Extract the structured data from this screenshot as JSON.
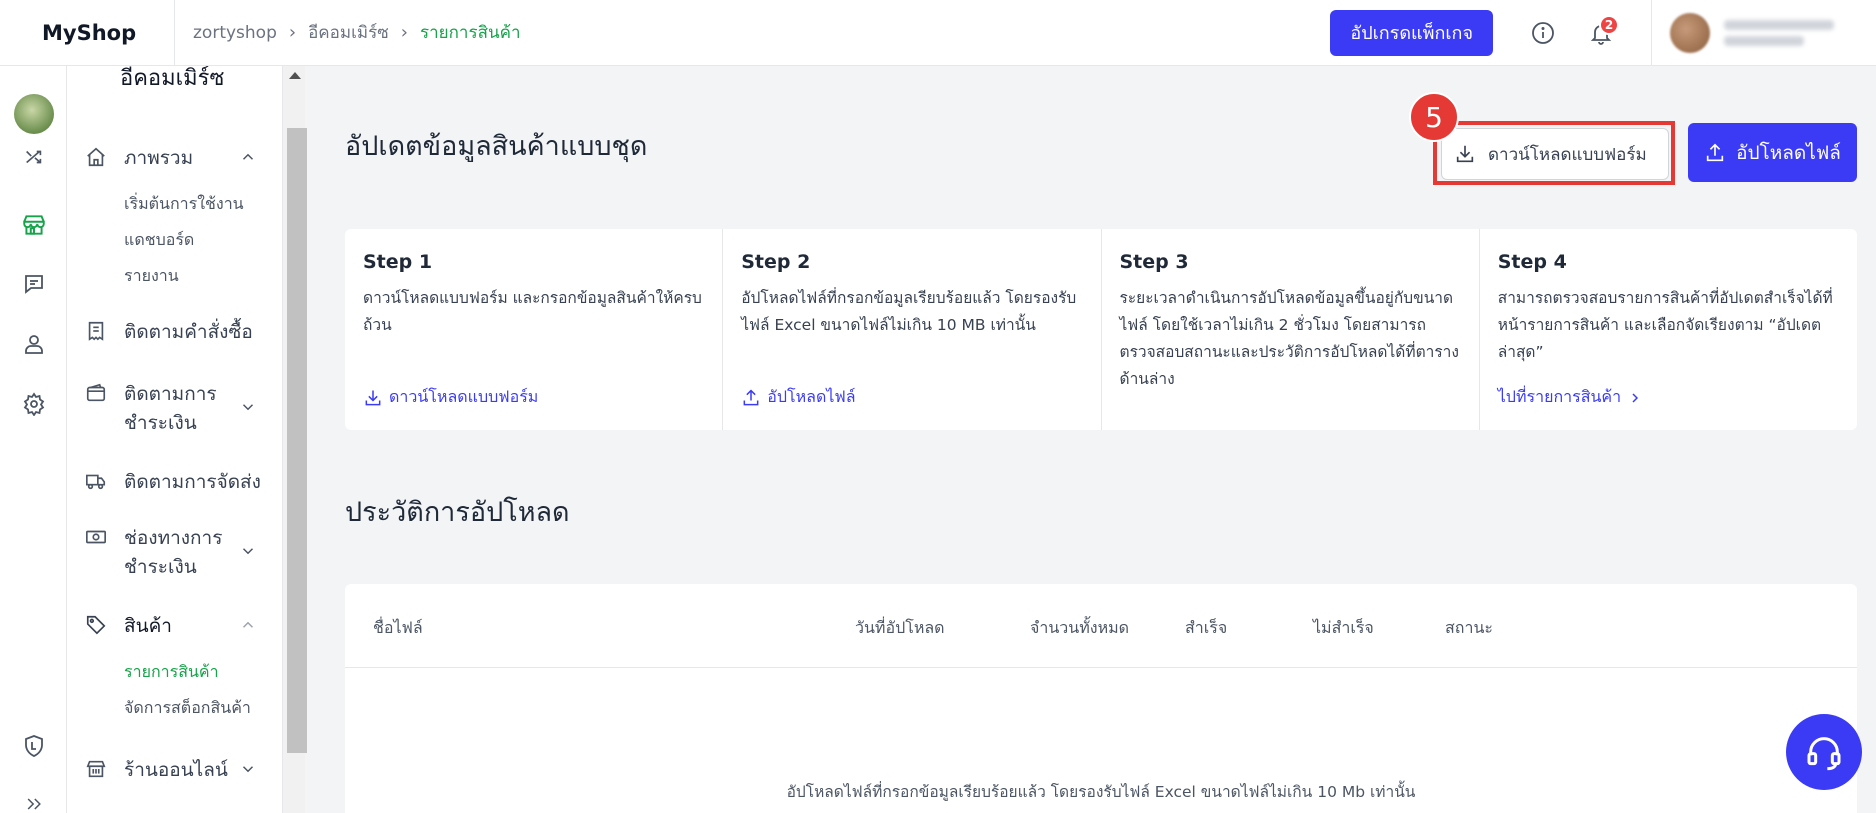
{
  "header": {
    "logo": "MyShop",
    "breadcrumb": [
      "zortyshop",
      "อีคอมเมิร์ซ",
      "รายการสินค้า"
    ],
    "upgrade_label": "อัปเกรดแพ็กเกจ",
    "notification_count": "2"
  },
  "sidebar": {
    "title": "อีคอมเมิร์ซ",
    "overview": "ภาพรวม",
    "overview_subs": [
      "เริ่มต้นการใช้งาน",
      "แดชบอร์ด",
      "รายงาน"
    ],
    "orders": "ติดตามคำสั่งซื้อ",
    "payments_line1": "ติดตามการ",
    "payments_line2": "ชำระเงิน",
    "shipping": "ติดตามการจัดส่ง",
    "channels_line1": "ช่องทางการ",
    "channels_line2": "ชำระเงิน",
    "products": "สินค้า",
    "product_subs": [
      "รายการสินค้า",
      "จัดการสต็อกสินค้า"
    ],
    "online_store": "ร้านออนไลน์"
  },
  "main": {
    "title": "อัปเดตข้อมูลสินค้าแบบชุด",
    "download_form_label": "ดาวน์โหลดแบบฟอร์ม",
    "upload_file_label": "อัปโหลดไฟล์",
    "annotation_number": "5",
    "steps": [
      {
        "title": "Step 1",
        "desc": "ดาวน์โหลดแบบฟอร์ม และกรอกข้อมูลสินค้าให้ครบถ้วน",
        "link": "ดาวน์โหลดแบบฟอร์ม"
      },
      {
        "title": "Step 2",
        "desc": "อัปโหลดไฟล์ที่กรอกข้อมูลเรียบร้อยแล้ว โดยรองรับไฟล์ Excel ขนาดไฟล์ไม่เกิน 10 MB เท่านั้น",
        "link": "อัปโหลดไฟล์"
      },
      {
        "title": "Step 3",
        "desc": "ระยะเวลาดำเนินการอัปโหลดข้อมูลขึ้นอยู่กับขนาดไฟล์ โดยใช้เวลาไม่เกิน 2 ชั่วโมง โดยสามารถตรวจสอบสถานะและประวัติการอัปโหลดได้ที่ตารางด้านล่าง"
      },
      {
        "title": "Step 4",
        "desc": "สามารถตรวจสอบรายการสินค้าที่อัปเดตสำเร็จได้ที่หน้ารายการสินค้า และเลือกจัดเรียงตาม “อัปเดตล่าสุด”",
        "link": "ไปที่รายการสินค้า"
      }
    ],
    "history_title": "ประวัติการอัปโหลด",
    "history_columns": [
      "ชื่อไฟล์",
      "วันที่อัปโหลด",
      "จำนวนทั้งหมด",
      "สำเร็จ",
      "ไม่สำเร็จ",
      "สถานะ"
    ],
    "empty_message": "อัปโหลดไฟล์ที่กรอกข้อมูลเรียบร้อยแล้ว โดยรองรับไฟล์ Excel ขนาดไฟล์ไม่เกิน 10 Mb เท่านั้น"
  },
  "colors": {
    "accent": "#3b3bf5",
    "active_green": "#16a34a",
    "annotation_red": "#e53935",
    "badge_red": "#ef4444"
  },
  "icons": [
    "home-icon",
    "receipt-icon",
    "wallet-icon",
    "truck-icon",
    "cash-icon",
    "tag-icon",
    "store-icon",
    "shuffle-icon",
    "shop-icon",
    "chat-icon",
    "user-icon",
    "gear-icon",
    "shield-icon",
    "double-chevron-icon",
    "info-icon",
    "bell-icon",
    "download-icon",
    "upload-icon",
    "headset-icon"
  ]
}
